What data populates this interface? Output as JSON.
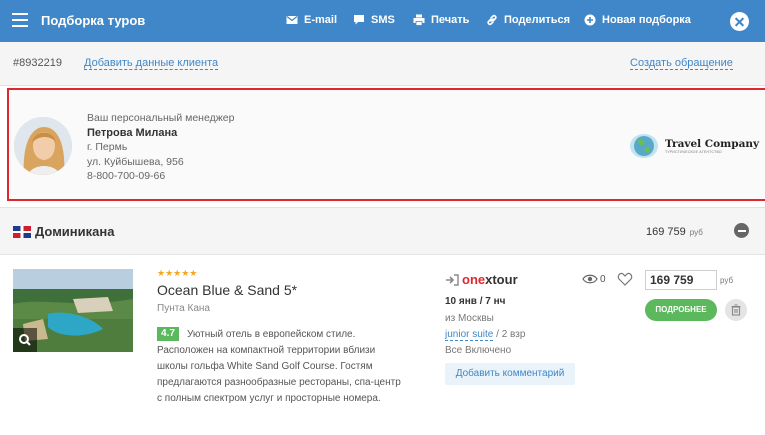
{
  "header": {
    "title": "Подборка туров",
    "actions": [
      {
        "label": "E-mail",
        "icon": "mail-icon"
      },
      {
        "label": "SMS",
        "icon": "chat-icon"
      },
      {
        "label": "Печать",
        "icon": "printer-icon"
      },
      {
        "label": "Поделиться",
        "icon": "link-icon"
      },
      {
        "label": "Новая подборка",
        "icon": "plus-circle-icon"
      }
    ],
    "close_icon": "close-icon"
  },
  "subheader": {
    "order_id": "#8932219",
    "add_client": "Добавить данные клиента",
    "create_request": "Создать обращение"
  },
  "manager": {
    "caption": "Ваш персональный менеджер",
    "name": "Петрова Милана",
    "city": "г. Пермь",
    "address": "ул. Куйбышева, 956",
    "phone": "8-800-700-09-66",
    "company_logo": "Travel Company",
    "company_tagline": "ТУРИСТИЧЕСКОЕ АГЕНТСТВО"
  },
  "country": {
    "name": "Доминикана",
    "total": "169 759",
    "currency": "руб"
  },
  "hotel": {
    "stars": "★★★★★",
    "name": "Ocean Blue & Sand 5*",
    "location": "Пунта Кана",
    "rating": "4.7",
    "description": "Уютный отель в европейском стиле. Расположен на компактной территории вблизи школы гольфа White Sand Golf Course. Гостям предлагаются разнообразные рестораны, спа-центр с полным спектром услуг и просторные номера.",
    "operator_prefix": "one",
    "operator_suffix": "xtour",
    "dates": "10 янв / 7 нч",
    "departure": "из Москвы",
    "room_type": "junior suite",
    "room_guests": " / 2 взр",
    "meal": "Все Включено",
    "add_comment": "Добавить комментарий",
    "views": "0",
    "price": "169 759",
    "currency": "руб",
    "details_button": "ПОДРОБНЕЕ"
  },
  "colors": {
    "header_bg": "#3f87c8",
    "highlight_border": "#e2262a",
    "accent_green": "#5cb85c",
    "star": "#f2a724"
  }
}
